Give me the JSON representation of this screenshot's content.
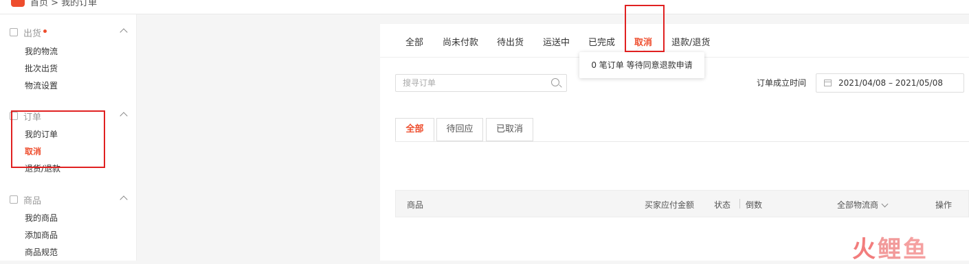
{
  "topbar": {
    "breadcrumb": "首页 > 我的订单"
  },
  "sidebar": {
    "sections": [
      {
        "title": "出货",
        "items": [
          "我的物流",
          "批次出货",
          "物流设置"
        ]
      },
      {
        "title": "订单",
        "items": [
          "我的订单",
          "取消",
          "退货/退款"
        ]
      },
      {
        "title": "商品",
        "items": [
          "我的商品",
          "添加商品",
          "商品规范"
        ]
      }
    ],
    "active_item": "取消"
  },
  "order_tabs": [
    "全部",
    "尚未付款",
    "待出货",
    "运送中",
    "已完成",
    "取消",
    "退款/退货"
  ],
  "active_tab": "取消",
  "tooltip": "0 笔订单 等待同意退款申请",
  "search": {
    "placeholder": "搜寻订单"
  },
  "date_filter": {
    "label": "订单成立时间",
    "value": "2021/04/08 – 2021/05/08"
  },
  "sub_tabs": [
    "全部",
    "待回应",
    "已取消"
  ],
  "table_headers": {
    "product": "商品",
    "amount": "买家应付金额",
    "status": "状态",
    "countdown": "倒数",
    "carrier": "全部物流商",
    "action": "操作"
  },
  "watermark": "火鲤鱼",
  "colors": {
    "accent": "#ee4d2d",
    "highlight_box": "#e02020"
  }
}
